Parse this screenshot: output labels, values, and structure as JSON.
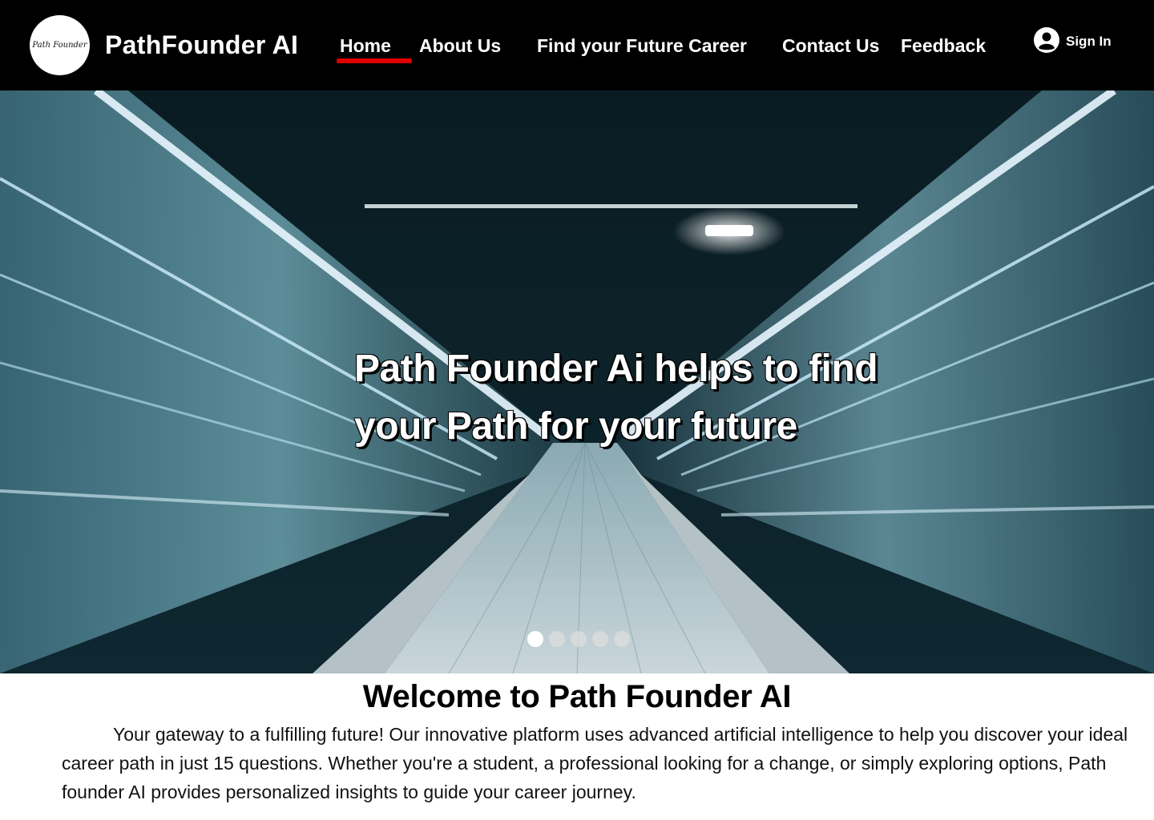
{
  "header": {
    "logo_text": "Path Founder",
    "brand": "PathFounder AI",
    "nav": [
      {
        "label": "Home",
        "active": true
      },
      {
        "label": "About Us"
      },
      {
        "label": "Find your Future Career"
      },
      {
        "label": "Contact Us"
      },
      {
        "label": "Feedback"
      }
    ],
    "sign_in": "Sign In",
    "active_color": "#e00000"
  },
  "hero": {
    "heading": "Path Founder Ai helps to find your Path for your future",
    "slide_count": 5,
    "active_slide": 1
  },
  "welcome": {
    "title": "Welcome to Path Founder AI",
    "body": "Your gateway to a fulfilling future! Our innovative platform uses advanced artificial intelligence to help you discover your ideal career path in just 15 questions. Whether you're a student, a professional looking for a change, or simply exploring options, Path founder AI provides personalized insights to guide your career journey."
  },
  "icons": {
    "sign_in": "user-circle-icon"
  }
}
